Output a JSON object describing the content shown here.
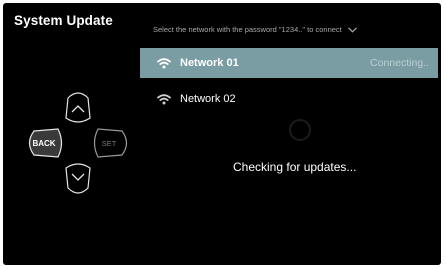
{
  "title": "System Update",
  "instruction": {
    "text": "Select the network with the password \"1234..\" to connect",
    "icon": "chevron-down-icon"
  },
  "networks": [
    {
      "name": "Network 01",
      "status": "Connecting..",
      "selected": true,
      "icon": "wifi-icon"
    },
    {
      "name": "Network 02",
      "status": "",
      "selected": false,
      "icon": "wifi-icon"
    }
  ],
  "status_message": "Checking for updates...",
  "dpad": {
    "back_label": "BACK",
    "set_label": "SET"
  },
  "colors": {
    "background": "#000000",
    "selected_row": "#7a9da3",
    "dpad_button": "#3a3a3a"
  }
}
